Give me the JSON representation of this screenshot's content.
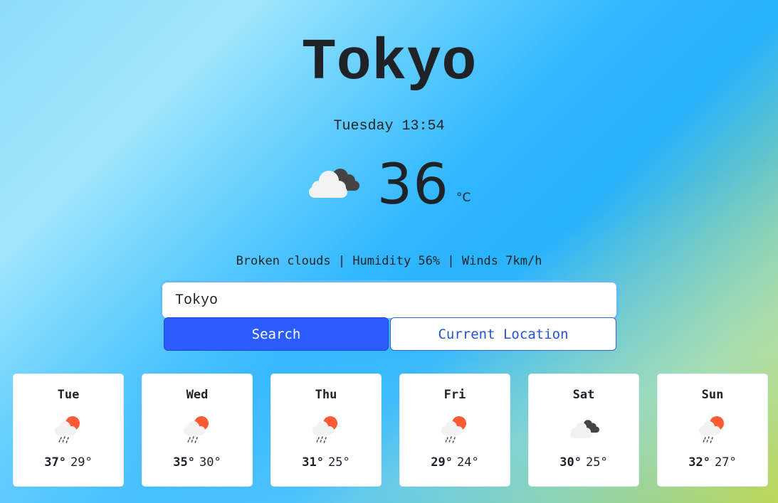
{
  "city": "Tokyo",
  "datetime": "Tuesday 13:54",
  "current": {
    "icon": "broken-clouds-icon",
    "temperature": "36",
    "unit": "°C",
    "description": "Broken clouds | Humidity 56% | Winds 7km/h"
  },
  "search": {
    "value": "Tokyo",
    "search_label": "Search",
    "location_label": "Current Location"
  },
  "forecast": [
    {
      "day": "Tue",
      "icon": "rain-sun-icon",
      "high": "37°",
      "low": "29°"
    },
    {
      "day": "Wed",
      "icon": "rain-sun-icon",
      "high": "35°",
      "low": "30°"
    },
    {
      "day": "Thu",
      "icon": "rain-sun-icon",
      "high": "31°",
      "low": "25°"
    },
    {
      "day": "Fri",
      "icon": "rain-sun-icon",
      "high": "29°",
      "low": "24°"
    },
    {
      "day": "Sat",
      "icon": "broken-clouds-icon",
      "high": "30°",
      "low": "25°"
    },
    {
      "day": "Sun",
      "icon": "rain-sun-icon",
      "high": "32°",
      "low": "27°"
    }
  ],
  "colors": {
    "accent": "#2a5cff",
    "sun": "#ff5a36",
    "dark_cloud": "#444444",
    "light_cloud": "#f2f2f2"
  }
}
